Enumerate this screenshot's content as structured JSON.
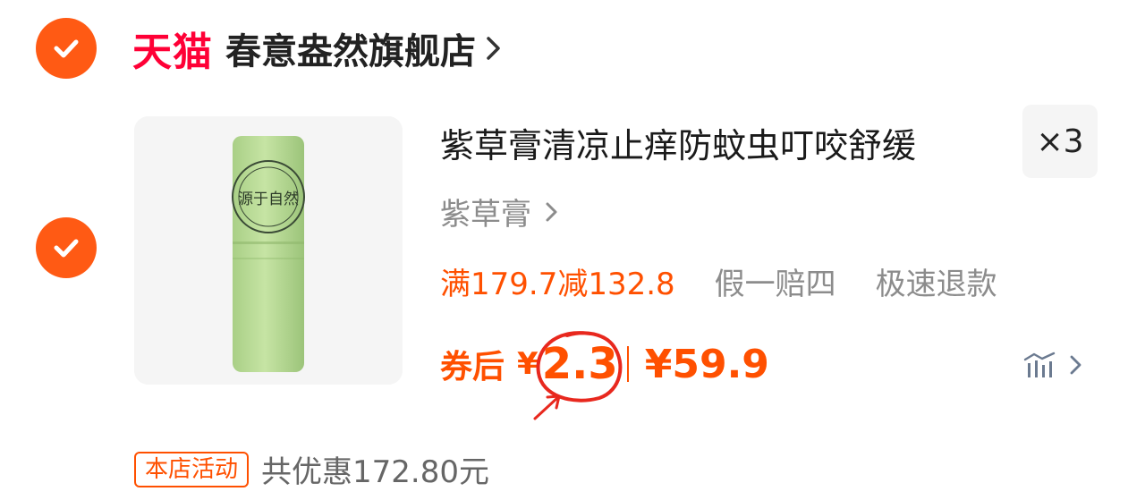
{
  "store": {
    "brand_label": "天猫",
    "name": "春意盎然旗舰店",
    "chevron_icon": "chevron-right-icon",
    "selected": true
  },
  "item": {
    "selected": true,
    "title": "紫草膏清凉止痒防蚊虫叮咬舒缓",
    "quantity": "×3",
    "sku": "紫草膏",
    "promo": {
      "discount": "满179.7减132.8",
      "tags": [
        "假一赔四",
        "极速退款"
      ]
    },
    "price": {
      "after_coupon_label": "券后",
      "currency": "¥",
      "after_coupon_value": "2.3",
      "original": "¥59.9"
    },
    "price_trend_icon": "price-trend-icon",
    "thumbnail_label": "源于自然"
  },
  "shop_promo": {
    "badge": "本店活动",
    "total_saved": "共优惠172.80元"
  },
  "colors": {
    "accent": "#ff5000",
    "check": "#ff5a14",
    "tmall": "#ff0036",
    "annotation": "#e8281e"
  }
}
